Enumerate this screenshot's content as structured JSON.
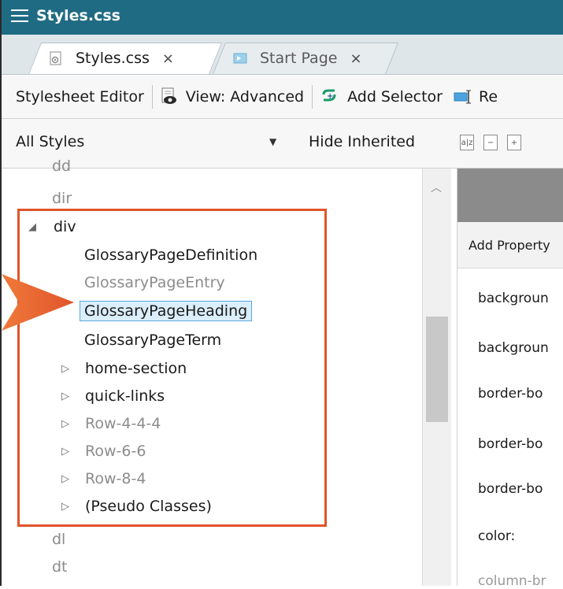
{
  "window": {
    "title": "Styles.css"
  },
  "tabs": [
    {
      "label": "Styles.css",
      "close": "×",
      "active": true
    },
    {
      "label": "Start Page",
      "close": "×",
      "active": false
    }
  ],
  "toolbar": {
    "editor_label": "Stylesheet Editor",
    "view_label": "View: Advanced",
    "add_selector_label": "Add Selector",
    "cut_label": "Re"
  },
  "filter": {
    "dropdown_value": "All Styles",
    "hide_inherited_label": "Hide Inherited"
  },
  "tree": {
    "cut_top_label": "dd",
    "items": [
      {
        "label": "dir"
      },
      {
        "label": "div"
      },
      {
        "label": "GlossaryPageDefinition"
      },
      {
        "label": "GlossaryPageEntry"
      },
      {
        "label": "GlossaryPageHeading"
      },
      {
        "label": "GlossaryPageTerm"
      },
      {
        "label": "home-section"
      },
      {
        "label": "quick-links"
      },
      {
        "label": "Row-4-4-4"
      },
      {
        "label": "Row-6-6"
      },
      {
        "label": "Row-8-4"
      },
      {
        "label": "(Pseudo Classes)"
      },
      {
        "label": "dl"
      },
      {
        "label": "dt"
      }
    ]
  },
  "properties": {
    "add_property_label": "Add Property",
    "items": [
      {
        "label": "backgroun"
      },
      {
        "label": "backgroun"
      },
      {
        "label": "border-bo"
      },
      {
        "label": "border-bo"
      },
      {
        "label": "border-bo"
      },
      {
        "label": "color:"
      },
      {
        "label": "column-br"
      }
    ]
  },
  "colors": {
    "titlebar": "#1f6b83",
    "highlight": "#e0542b",
    "selection": "#daeefb",
    "accent_green": "#1a9b6a"
  }
}
